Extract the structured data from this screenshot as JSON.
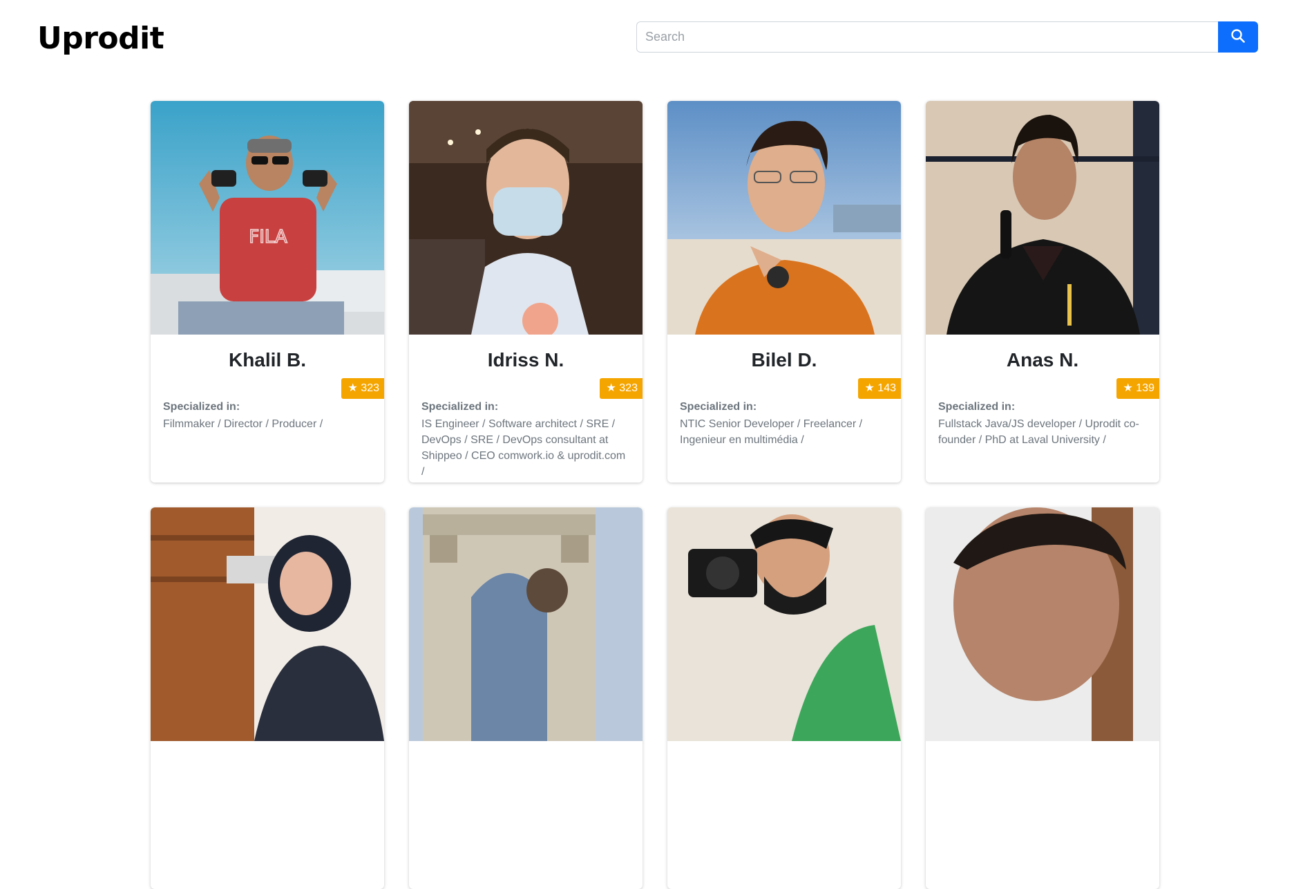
{
  "app": {
    "title": "Uprodit"
  },
  "search": {
    "placeholder": "Search",
    "value": ""
  },
  "icons": {
    "search_button": "search-icon",
    "rating": "star-icon"
  },
  "colors": {
    "accent": "#0d6efd",
    "rating_badge": "#f5a500"
  },
  "profiles": [
    {
      "name": "Khalil B.",
      "rating": "★ 323",
      "label": "Specialized in:",
      "specialties": "Filmmaker / Director / Producer /"
    },
    {
      "name": "Idriss N.",
      "rating": "★ 323",
      "label": "Specialized in:",
      "specialties": "IS Engineer / Software architect / SRE / DevOps / SRE / DevOps consultant at Shippeo / CEO comwork.io & uprodit.com /"
    },
    {
      "name": "Bilel D.",
      "rating": "★ 143",
      "label": "Specialized in:",
      "specialties": "NTIC Senior Developer / Freelancer / Ingenieur en multimédia /"
    },
    {
      "name": "Anas N.",
      "rating": "★ 139",
      "label": "Specialized in:",
      "specialties": "Fullstack Java/JS developer / Uprodit co-founder / PhD at Laval University /"
    },
    {
      "name": "",
      "rating": "",
      "label": "",
      "specialties": ""
    },
    {
      "name": "",
      "rating": "",
      "label": "",
      "specialties": ""
    },
    {
      "name": "",
      "rating": "",
      "label": "",
      "specialties": ""
    },
    {
      "name": "",
      "rating": "",
      "label": "",
      "specialties": ""
    }
  ]
}
